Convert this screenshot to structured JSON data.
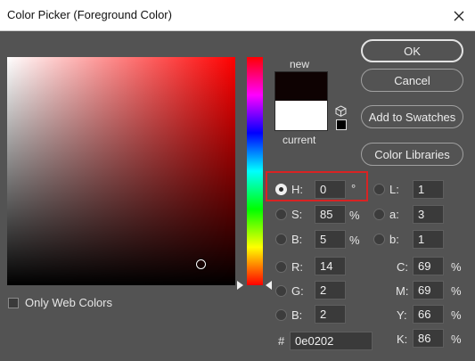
{
  "window": {
    "title": "Color Picker (Foreground Color)"
  },
  "buttons": {
    "ok": "OK",
    "cancel": "Cancel",
    "add_to_swatches": "Add to Swatches",
    "color_libraries": "Color Libraries"
  },
  "swatches": {
    "new_label": "new",
    "current_label": "current",
    "new_color": "#0e0202",
    "current_color": "#ffffff"
  },
  "only_web_colors": {
    "label": "Only Web Colors",
    "checked": false
  },
  "hsb": {
    "h": {
      "label": "H:",
      "value": "0",
      "unit": "°",
      "selected": true
    },
    "s": {
      "label": "S:",
      "value": "85",
      "unit": "%"
    },
    "b": {
      "label": "B:",
      "value": "5",
      "unit": "%"
    }
  },
  "rgb": {
    "r": {
      "label": "R:",
      "value": "14"
    },
    "g": {
      "label": "G:",
      "value": "2"
    },
    "b": {
      "label": "B:",
      "value": "2"
    }
  },
  "lab": {
    "l": {
      "label": "L:",
      "value": "1"
    },
    "a": {
      "label": "a:",
      "value": "3"
    },
    "b": {
      "label": "b:",
      "value": "1"
    }
  },
  "cmyk": {
    "c": {
      "label": "C:",
      "value": "69",
      "unit": "%"
    },
    "m": {
      "label": "M:",
      "value": "69",
      "unit": "%"
    },
    "y": {
      "label": "Y:",
      "value": "66",
      "unit": "%"
    },
    "k": {
      "label": "K:",
      "value": "86",
      "unit": "%"
    }
  },
  "hex": {
    "label": "#",
    "value": "0e0202"
  },
  "field": {
    "saturation": 0.85,
    "brightness": 0.05,
    "hue": 0
  },
  "colors": {
    "highlight": "#d92323",
    "background": "#535353"
  }
}
